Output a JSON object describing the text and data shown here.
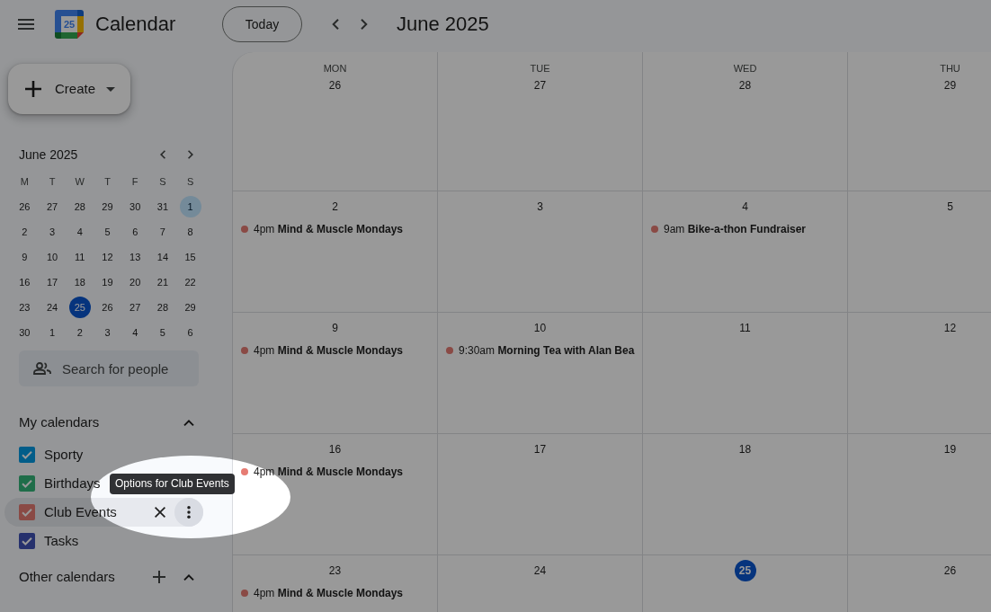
{
  "header": {
    "app_name": "Calendar",
    "logo_day": "25",
    "today_button": "Today",
    "title": "June 2025"
  },
  "create_button": {
    "label": "Create"
  },
  "mini_calendar": {
    "title": "June 2025",
    "weekdays": [
      "M",
      "T",
      "W",
      "T",
      "F",
      "S",
      "S"
    ],
    "weeks": [
      [
        {
          "label": "26",
          "selected": false,
          "today": false
        },
        {
          "label": "27",
          "selected": false,
          "today": false
        },
        {
          "label": "28",
          "selected": false,
          "today": false
        },
        {
          "label": "29",
          "selected": false,
          "today": false
        },
        {
          "label": "30",
          "selected": false,
          "today": false
        },
        {
          "label": "31",
          "selected": false,
          "today": false
        },
        {
          "label": "1",
          "selected": true,
          "today": false
        }
      ],
      [
        {
          "label": "2",
          "selected": false,
          "today": false
        },
        {
          "label": "3",
          "selected": false,
          "today": false
        },
        {
          "label": "4",
          "selected": false,
          "today": false
        },
        {
          "label": "5",
          "selected": false,
          "today": false
        },
        {
          "label": "6",
          "selected": false,
          "today": false
        },
        {
          "label": "7",
          "selected": false,
          "today": false
        },
        {
          "label": "8",
          "selected": false,
          "today": false
        }
      ],
      [
        {
          "label": "9",
          "selected": false,
          "today": false
        },
        {
          "label": "10",
          "selected": false,
          "today": false
        },
        {
          "label": "11",
          "selected": false,
          "today": false
        },
        {
          "label": "12",
          "selected": false,
          "today": false
        },
        {
          "label": "13",
          "selected": false,
          "today": false
        },
        {
          "label": "14",
          "selected": false,
          "today": false
        },
        {
          "label": "15",
          "selected": false,
          "today": false
        }
      ],
      [
        {
          "label": "16",
          "selected": false,
          "today": false
        },
        {
          "label": "17",
          "selected": false,
          "today": false
        },
        {
          "label": "18",
          "selected": false,
          "today": false
        },
        {
          "label": "19",
          "selected": false,
          "today": false
        },
        {
          "label": "20",
          "selected": false,
          "today": false
        },
        {
          "label": "21",
          "selected": false,
          "today": false
        },
        {
          "label": "22",
          "selected": false,
          "today": false
        }
      ],
      [
        {
          "label": "23",
          "selected": false,
          "today": false
        },
        {
          "label": "24",
          "selected": false,
          "today": false
        },
        {
          "label": "25",
          "selected": false,
          "today": true
        },
        {
          "label": "26",
          "selected": false,
          "today": false
        },
        {
          "label": "27",
          "selected": false,
          "today": false
        },
        {
          "label": "28",
          "selected": false,
          "today": false
        },
        {
          "label": "29",
          "selected": false,
          "today": false
        }
      ],
      [
        {
          "label": "30",
          "selected": false,
          "today": false
        },
        {
          "label": "1",
          "selected": false,
          "today": false
        },
        {
          "label": "2",
          "selected": false,
          "today": false
        },
        {
          "label": "3",
          "selected": false,
          "today": false
        },
        {
          "label": "4",
          "selected": false,
          "today": false
        },
        {
          "label": "5",
          "selected": false,
          "today": false
        },
        {
          "label": "6",
          "selected": false,
          "today": false
        }
      ]
    ]
  },
  "people_search": {
    "placeholder": "Search for people"
  },
  "my_calendars": {
    "title": "My calendars",
    "expanded": true,
    "items": [
      {
        "label": "Sporty",
        "checked": true,
        "color": "#025d89",
        "hovered": false
      },
      {
        "label": "Birthdays",
        "checked": true,
        "color": "#1f6d49",
        "hovered": false
      },
      {
        "label": "Club Events",
        "checked": true,
        "color": "#8a4a45",
        "hovered": true
      },
      {
        "label": "Tasks",
        "checked": true,
        "color": "#26316d",
        "hovered": false
      }
    ]
  },
  "tooltip": {
    "text": "Options for Club Events"
  },
  "other_calendars": {
    "title": "Other calendars",
    "expanded": true
  },
  "month_grid": {
    "columns": [
      "MON",
      "TUE",
      "WED",
      "THU"
    ],
    "weeks": [
      {
        "days": [
          {
            "date": "26",
            "today": false
          },
          {
            "date": "27",
            "today": false
          },
          {
            "date": "28",
            "today": false
          },
          {
            "date": "29",
            "today": false
          }
        ]
      },
      {
        "days": [
          {
            "date": "2",
            "today": false,
            "events": [
              {
                "time": "4pm",
                "title": "Mind & Muscle Mondays",
                "color": "#8a4a45"
              }
            ]
          },
          {
            "date": "3",
            "today": false
          },
          {
            "date": "4",
            "today": false,
            "events": [
              {
                "time": "9am",
                "title": "Bike-a-thon Fundraiser",
                "color": "#8a4a45"
              }
            ]
          },
          {
            "date": "5",
            "today": false
          }
        ]
      },
      {
        "days": [
          {
            "date": "9",
            "today": false,
            "events": [
              {
                "time": "4pm",
                "title": "Mind & Muscle Mondays",
                "color": "#8a4a45"
              }
            ]
          },
          {
            "date": "10",
            "today": false,
            "events": [
              {
                "time": "9:30am",
                "title": "Morning Tea with Alan Bea",
                "color": "#8a4a45"
              }
            ]
          },
          {
            "date": "11",
            "today": false
          },
          {
            "date": "12",
            "today": false
          }
        ]
      },
      {
        "days": [
          {
            "date": "16",
            "today": false,
            "events": [
              {
                "time": "4pm",
                "title": "Mind & Muscle Mondays",
                "color": "#e67c73"
              }
            ]
          },
          {
            "date": "17",
            "today": false
          },
          {
            "date": "18",
            "today": false
          },
          {
            "date": "19",
            "today": false
          }
        ]
      },
      {
        "days": [
          {
            "date": "23",
            "today": false,
            "events": [
              {
                "time": "4pm",
                "title": "Mind & Muscle Mondays",
                "color": "#8a4a45"
              }
            ]
          },
          {
            "date": "24",
            "today": false
          },
          {
            "date": "25",
            "today": true
          },
          {
            "date": "26",
            "today": false
          }
        ]
      }
    ]
  },
  "spotlight": {
    "shown": true
  }
}
